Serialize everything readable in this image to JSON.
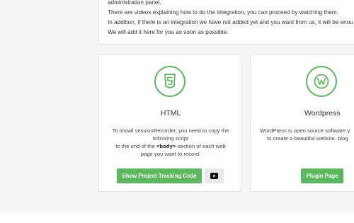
{
  "intro": {
    "line0": "administration panel.",
    "line1": "There are videos explaining how to do the integration, you can proceed by watching them.",
    "line2": "In addition, if there is an integration we have not added yet and you want from us, it will be enou",
    "line3": "We will add it here for you as soon as possible."
  },
  "cards": [
    {
      "title": "HTML",
      "icon": "html5-icon",
      "desc": {
        "line1": "To install sessionRecorder, you need to copy the",
        "line2": "following script",
        "line3_pre": "to the end of the ",
        "line3_tag": "<body>",
        "line3_post": "-section of each web",
        "line4": "page you want to record."
      },
      "button": "Show Project Tracking Code",
      "video_icon": "youtube-play-icon"
    },
    {
      "title": "Wordpress",
      "icon": "wordpress-icon",
      "desc": {
        "line1": "WordPress is open source software y",
        "line2": "to create a beautiful website, blog"
      },
      "button": "Plugin Page"
    }
  ],
  "colors": {
    "accent": "#5cb85c",
    "background": "#f5f5f5"
  }
}
